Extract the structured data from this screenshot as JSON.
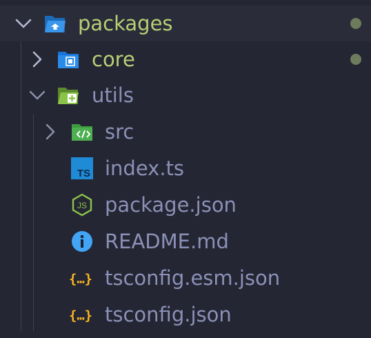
{
  "explorer": {
    "root": {
      "label": "packages",
      "expanded": true,
      "modified": true,
      "icon": "folder-open-packages-icon"
    },
    "items": [
      {
        "label": "core",
        "expanded": false,
        "modified": true,
        "icon": "folder-core-icon"
      },
      {
        "label": "utils",
        "expanded": true,
        "modified": false,
        "icon": "folder-open-utils-icon"
      },
      {
        "label": "src",
        "expanded": false,
        "icon": "folder-src-icon"
      },
      {
        "label": "index.ts",
        "icon": "typescript-file-icon"
      },
      {
        "label": "package.json",
        "icon": "nodejs-file-icon"
      },
      {
        "label": "README.md",
        "icon": "info-file-icon"
      },
      {
        "label": "tsconfig.esm.json",
        "icon": "json-file-icon"
      },
      {
        "label": "tsconfig.json",
        "icon": "json-file-icon"
      }
    ]
  },
  "colors": {
    "background": "#252634",
    "modified_text": "#b9cf74",
    "normal_text": "#8b91b6",
    "modified_dot": "#6e7b5c"
  }
}
